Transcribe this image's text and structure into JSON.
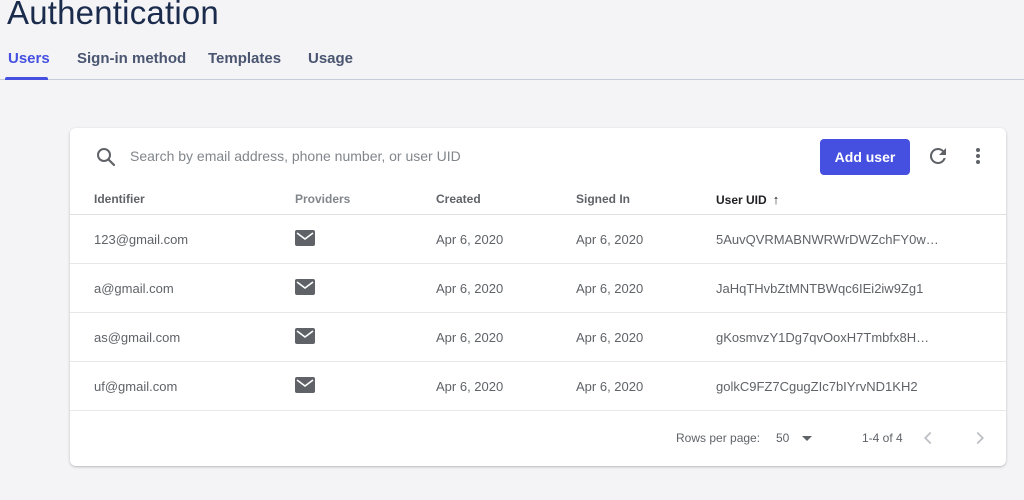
{
  "page": {
    "title": "Authentication"
  },
  "tabs": [
    {
      "label": "Users",
      "active": true
    },
    {
      "label": "Sign-in method",
      "active": false
    },
    {
      "label": "Templates",
      "active": false
    },
    {
      "label": "Usage",
      "active": false
    }
  ],
  "toolbar": {
    "search_icon": "search-icon",
    "search_placeholder": "Search by email address, phone number, or user UID",
    "search_value": "",
    "add_user_label": "Add user",
    "refresh_icon": "refresh-icon",
    "more_icon": "more-vert-icon"
  },
  "table": {
    "columns": [
      "Identifier",
      "Providers",
      "Created",
      "Signed In",
      "User UID"
    ],
    "sorted_column": "User UID",
    "sort_direction": "ascending",
    "rows": [
      {
        "identifier": "123@gmail.com",
        "provider_icon": "mail-icon",
        "created": "Apr 6, 2020",
        "signed_in": "Apr 6, 2020",
        "uid": "5AuvQVRMABNWRWrDWZchFY0w…"
      },
      {
        "identifier": "a@gmail.com",
        "provider_icon": "mail-icon",
        "created": "Apr 6, 2020",
        "signed_in": "Apr 6, 2020",
        "uid": "JaHqTHvbZtMNTBWqc6IEi2iw9Zg1"
      },
      {
        "identifier": "as@gmail.com",
        "provider_icon": "mail-icon",
        "created": "Apr 6, 2020",
        "signed_in": "Apr 6, 2020",
        "uid": "gKosmvzY1Dg7qvOoxH7Tmbfx8H…"
      },
      {
        "identifier": "uf@gmail.com",
        "provider_icon": "mail-icon",
        "created": "Apr 6, 2020",
        "signed_in": "Apr 6, 2020",
        "uid": "golkC9FZ7CgugZIc7bIYrvND1KH2"
      }
    ]
  },
  "pagination": {
    "rows_per_page_label": "Rows per page:",
    "rows_per_page_value": "50",
    "range_label": "1-4 of 4",
    "prev_icon": "chevron-left-icon",
    "next_icon": "chevron-right-icon"
  },
  "colors": {
    "accent": "#4650e0",
    "title": "#1a2b4c",
    "background": "#f4f4f7"
  }
}
